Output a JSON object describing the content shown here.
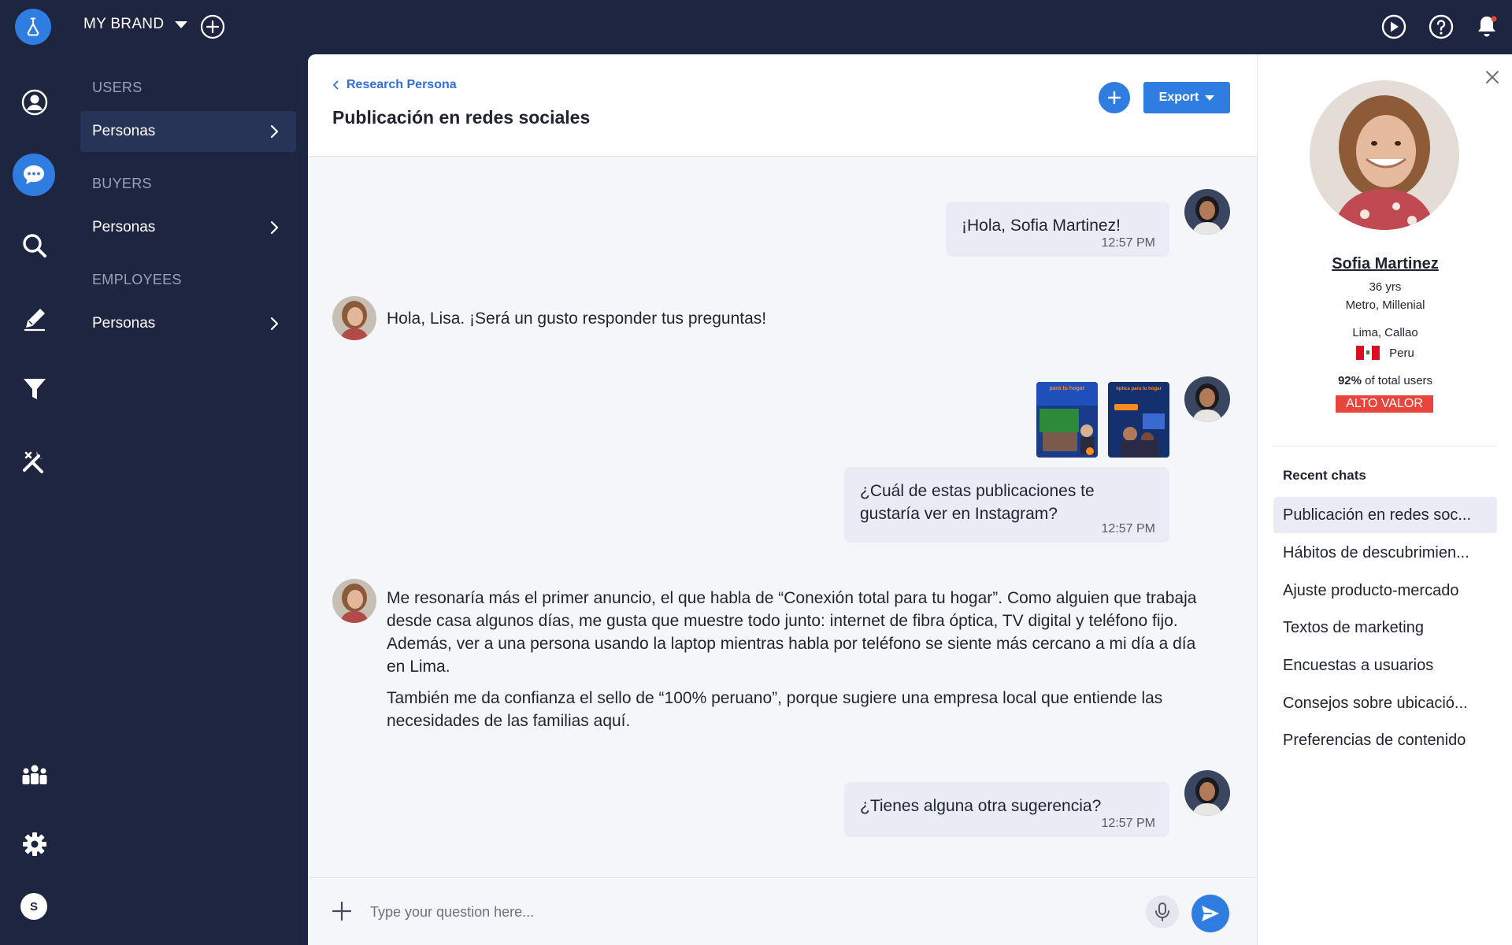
{
  "topbar": {
    "brand": "MY BRAND",
    "icons": [
      "play-icon",
      "help-icon",
      "bell-icon"
    ]
  },
  "rail": {
    "icons": [
      "user-circle-icon",
      "chat-icon",
      "search-icon",
      "pencil-icon",
      "filter-icon",
      "tools-icon",
      "team-icon",
      "gear-icon"
    ],
    "avatar_initial": "S"
  },
  "subnav": {
    "sections": [
      {
        "title": "USERS",
        "item": "Personas"
      },
      {
        "title": "BUYERS",
        "item": "Personas"
      },
      {
        "title": "EMPLOYEES",
        "item": "Personas"
      }
    ]
  },
  "header": {
    "breadcrumb": "Research Persona",
    "title": "Publicación en redes sociales",
    "export_label": "Export"
  },
  "messages": {
    "m1": {
      "text": "¡Hola, Sofia Martinez!",
      "time": "12:57 PM"
    },
    "r1": {
      "text": "Hola, Lisa. ¡Será un gusto responder tus preguntas!"
    },
    "m2": {
      "line1": "¿Cuál de estas publicaciones te",
      "line2": "gustaría ver en Instagram?",
      "time": "12:57 PM"
    },
    "r2": {
      "p1": "Me resonaría más el primer anuncio, el que habla de “Conexión total para tu hogar”. Como alguien que trabaja desde casa algunos días, me gusta que muestre todo junto: internet de fibra óptica, TV digital y teléfono fijo. Además, ver a una persona usando la laptop mientras habla por teléfono se siente más cercano a mi día a día en Lima.",
      "p2": "También me da confianza el sello de “100% peruano”, porque sugiere una empresa local que entiende las necesidades de las familias aquí."
    },
    "m3": {
      "text": "¿Tienes alguna otra sugerencia?",
      "time": "12:57 PM"
    },
    "thumb1_text": "para tu hogar",
    "thumb2_text": "óptica para tu hogar"
  },
  "input": {
    "placeholder": "Type your question here..."
  },
  "profile": {
    "name": "Sofia Martinez",
    "age": "36 yrs",
    "segment": "Metro, Millenial",
    "city": "Lima, Callao",
    "country": "Peru",
    "share_pct": "92%",
    "share_suffix": " of total users",
    "badge": "ALTO VALOR",
    "flag_colors": [
      "#d91023",
      "#ffffff",
      "#d91023"
    ]
  },
  "recent": {
    "title": "Recent chats",
    "items": [
      "Publicación en redes soc...",
      "Hábitos de descubrimien...",
      "Ajuste producto-mercado",
      "Textos de marketing",
      "Encuestas a usuarios",
      "Consejos sobre ubicació...",
      "Preferencias de contenido"
    ]
  },
  "colors": {
    "accent": "#2f7de1",
    "sidebar": "#1e2540",
    "badge": "#e8453c"
  }
}
